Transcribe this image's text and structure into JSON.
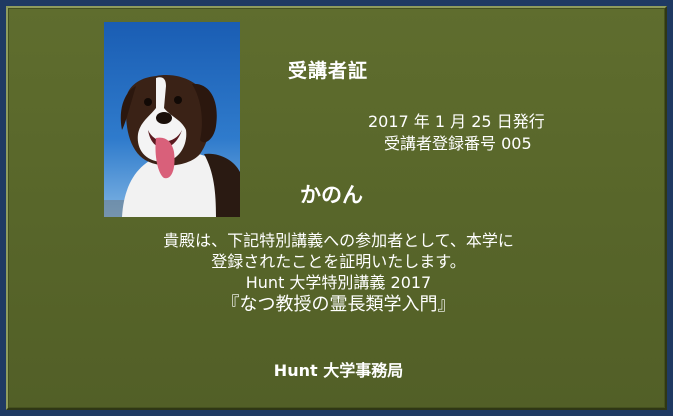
{
  "certificate": {
    "title": "受講者証",
    "issue_date": "2017 年 1 月 25 日発行",
    "registration_number": "受講者登録番号 005",
    "recipient_name": "かのん",
    "body_lines": [
      "貴殿は、下記特別講義への参加者として、本学に",
      "登録されたことを証明いたします。",
      "Hunt 大学特別講義 2017"
    ],
    "course_title": "『なつ教授の霊長類学入門』",
    "issuer": "Hunt 大学事務局",
    "photo_icon": "dog-photo"
  },
  "colors": {
    "outer_frame": "#1f3a63",
    "card_background": "#5a682b",
    "text": "#ffffff"
  }
}
